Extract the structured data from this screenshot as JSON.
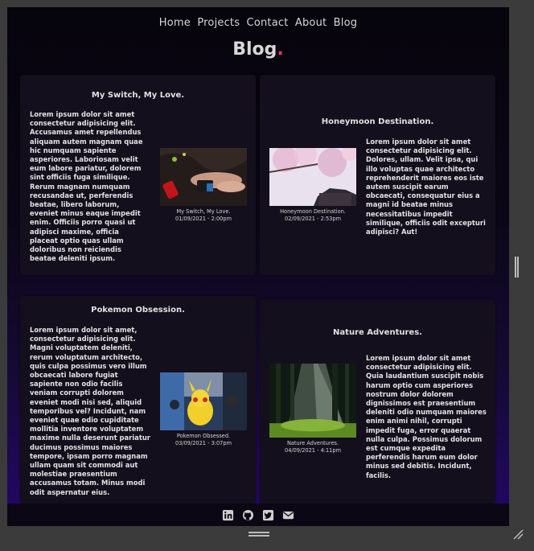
{
  "nav": {
    "items": [
      "Home",
      "Projects",
      "Contact",
      "About",
      "Blog"
    ]
  },
  "page": {
    "title": "Blog",
    "title_dot": ".",
    "accent_color": "#e8336b"
  },
  "posts": [
    {
      "title": "My Switch, My Love.",
      "text": "Lorem ipsum dolor sit amet consectetur adipisicing elit. Accusamus amet repellendus aliquam autem magnam quae hic numquam sapiente asperiores. Laboriosam velit eum labore pariatur, dolorem sint officiis fuga similique. Rerum magnam numquam recusandae ut, perferendis beatae, libero laborum, eveniet minus eaque impedit enim. Officiis porro quasi ut adipisci maxime, officia placeat optio quas ullam doloribus non reiciendis beatae deleniti ipsum.",
      "caption": "My Switch, My Love.",
      "date": "01/09/2021 - 2:00pm"
    },
    {
      "title": "Honeymoon Destination.",
      "text": "Lorem ipsum dolor sit amet consectetur adipisicing elit. Dolores, ullam. Velit ipsa, qui illo voluptas quae architecto reprehenderit maiores eos iste autem suscipit earum obcaecati, consequatur eius a magni id beatae minus necessitatibus impedit similique, officiis odit excepturi adipisci? Aut!",
      "caption": "Honeymoon Destination.",
      "date": "02/09/2021 - 2:53pm"
    },
    {
      "title": "Pokemon Obsession.",
      "text": "Lorem ipsum dolor sit amet, consectetur adipisicing elit. Magni voluptatem deleniti, rerum voluptatum architecto, quis culpa possimus vero illum obcaecati labore fugiat sapiente non odio facilis veniam corrupti dolorem eveniet modi nisi sed, aliquid temporibus vel? Incidunt, nam eveniet quae odio cupiditate mollitia inventore voluptatem maxime nulla deserunt pariatur ducimus possimus maiores tempore, ipsam porro magnam ullam quam sit commodi aut molestiae praesentium accusamus totam. Minus modi odit aspernatur eius.",
      "caption": "Pokemon Obsessed.",
      "date": "03/09/2021 - 3:07pm"
    },
    {
      "title": "Nature Adventures.",
      "text": "Lorem ipsum dolor sit amet consectetur adipisicing elit. Quia laudantium suscipit nobis harum optio cum asperiores nostrum dolor dolorem dignissimos est praesentium deleniti odio numquam maiores enim animi nihil, corrupti impedit fuga, error quaerat nulla culpa. Possimus dolorum est cumque expedita perferendis harum eum dolor minus sed debitis. Incidunt, facilis.",
      "caption": "Nature Adventures.",
      "date": "04/09/2021 - 4:11pm"
    }
  ],
  "footer": {
    "icons": [
      "linkedin-icon",
      "github-icon",
      "twitter-icon",
      "mail-icon"
    ]
  },
  "colors": {
    "background_top": "#06040c",
    "background_bottom": "#22086a",
    "card": "#140f1c"
  }
}
